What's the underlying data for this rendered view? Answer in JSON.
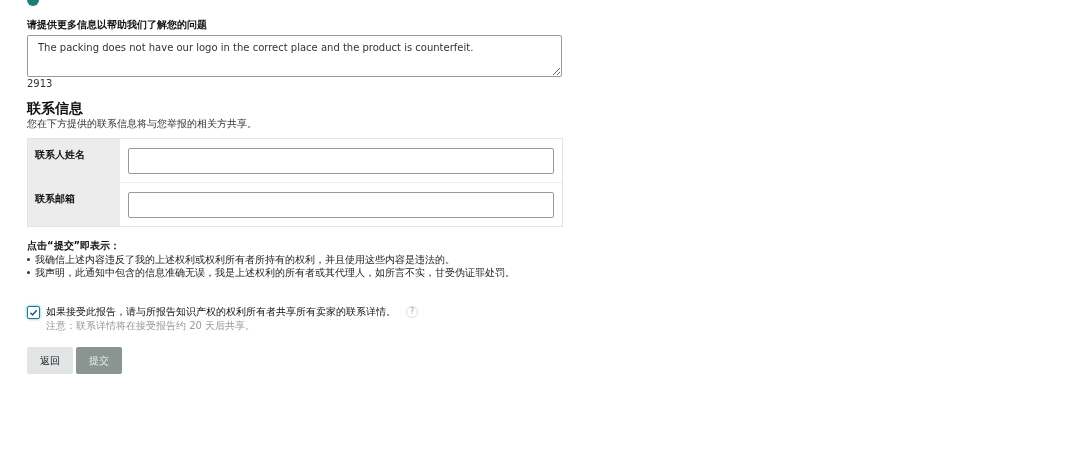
{
  "radio": {
    "selected": true
  },
  "details": {
    "label": "请提供更多信息以帮助我们了解您的问题",
    "value": "The packing does not have our logo in the correct place and the product is counterfeit.",
    "count": "2913"
  },
  "contact": {
    "title": "联系信息",
    "subtitle": "您在下方提供的联系信息将与您举报的相关方共享。",
    "fields": [
      {
        "label": "联系人姓名"
      },
      {
        "label": "联系邮箱"
      }
    ]
  },
  "statement": {
    "title": "点击“提交”即表示：",
    "items": [
      "我确信上述内容违反了我的上述权利或权利所有者所持有的权利，并且使用这些内容是违法的。",
      "我声明，此通知中包含的信息准确无误，我是上述权利的所有者或其代理人，如所言不实，甘受伪证罪处罚。"
    ]
  },
  "share": {
    "checked": true,
    "label": "如果接受此报告，请与所报告知识产权的权利所有者共享所有卖家的联系详情。",
    "help": "?",
    "note": "注意：联系详情将在接受报告约 20 天后共享。"
  },
  "buttons": [
    {
      "label": "返回",
      "kind": "secondary"
    },
    {
      "label": "提交",
      "kind": "primary"
    }
  ]
}
